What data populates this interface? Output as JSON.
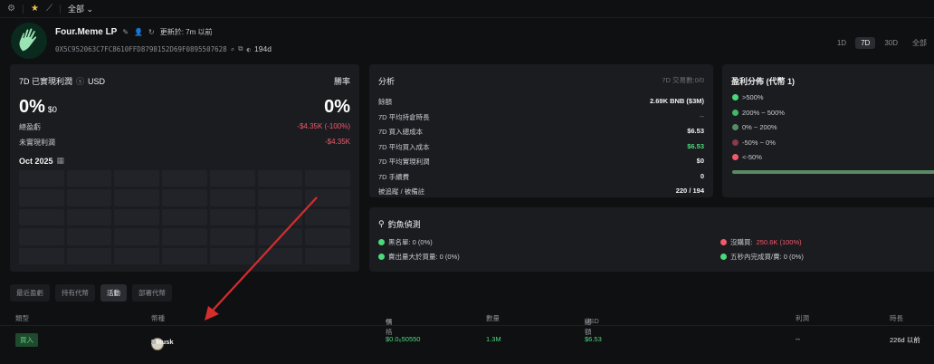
{
  "topbar": {
    "all_label": "全部",
    "icons": [
      "settings-icon",
      "star-icon",
      "chart-icon",
      "chevron-down-icon"
    ]
  },
  "profile": {
    "name": "Four.Meme LP",
    "updated": "更新於: 7m 以前",
    "address": "0X5C952063C7FC8610FFD8798152D69F0895507628",
    "days": "194d"
  },
  "periods": [
    "1D",
    "7D",
    "30D",
    "全部"
  ],
  "active_period": "7D",
  "pnl_card": {
    "title": "7D 已實現利潤",
    "currency": "USD",
    "win_rate_label": "勝率",
    "pnl_pct": "0%",
    "pnl_usd": "$0",
    "win_rate": "0%",
    "total_pnl_label": "總盈虧",
    "total_pnl_value": "-$4.35K (-100%)",
    "unrealized_label": "未實現利潤",
    "unrealized_value": "-$4.35K",
    "month": "Oct 2025"
  },
  "analysis": {
    "title": "分析",
    "tx_count": "7D 交易數:0/0",
    "rows": [
      {
        "label": "餘額",
        "value": "2.69K BNB ($3M)",
        "style": "w"
      },
      {
        "label": "7D 平均持倉時長",
        "value": "--",
        "style": "m"
      },
      {
        "label": "7D 買入總成本",
        "value": "$6.53",
        "style": "w"
      },
      {
        "label": "7D 平均買入成本",
        "value": "$6.53",
        "style": "g"
      },
      {
        "label": "7D 平均實現利潤",
        "value": "$0",
        "style": "w"
      },
      {
        "label": "7D 手續費",
        "value": "0",
        "style": "w"
      },
      {
        "label": "被追蹤 / 被備註",
        "value": "220 / 194",
        "style": "w"
      }
    ]
  },
  "distribution": {
    "title": "盈利分佈 (代幣 1)",
    "items": [
      {
        "label": ">500%",
        "color": "#4cd97b"
      },
      {
        "label": "200% ~ 500%",
        "color": "#3fb86a"
      },
      {
        "label": "0% ~ 200%",
        "color": "#5a8a63"
      },
      {
        "label": "-50% ~ 0%",
        "color": "#8a3a48"
      },
      {
        "label": "<-50%",
        "color": "#f05a6b"
      }
    ]
  },
  "phishing": {
    "title": "釣魚偵測",
    "items": [
      {
        "label": "黑名單: 0 (0%)",
        "color": "#4cd97b",
        "value": ""
      },
      {
        "label": "沒購買: ",
        "color": "#f05a6b",
        "value": "250.6K (100%)"
      },
      {
        "label": "賣出量大於買量: 0 (0%)",
        "color": "#4cd97b",
        "value": ""
      },
      {
        "label": "五秒內完成買/賣: 0 (0%)",
        "color": "#4cd97b",
        "value": ""
      }
    ]
  },
  "tabs": [
    "最近盈虧",
    "持有代幣",
    "活動",
    "部署代幣"
  ],
  "active_tab": "活動",
  "table": {
    "headers": {
      "type": "類型",
      "token": "幣種",
      "price": "價格",
      "amount": "數量",
      "total": "總額",
      "total_unit": "USD",
      "profit": "利潤",
      "age": "時長"
    },
    "row": {
      "type": "買入",
      "trader": "DMusk",
      "price": "$0.0₆50550",
      "amount": "1.3M",
      "total": "$6.53",
      "profit": "--",
      "age": "226d 以前"
    }
  },
  "colors": {
    "green": "#4cd97b",
    "red": "#f05a6b",
    "annotation": "#d62d2d"
  }
}
